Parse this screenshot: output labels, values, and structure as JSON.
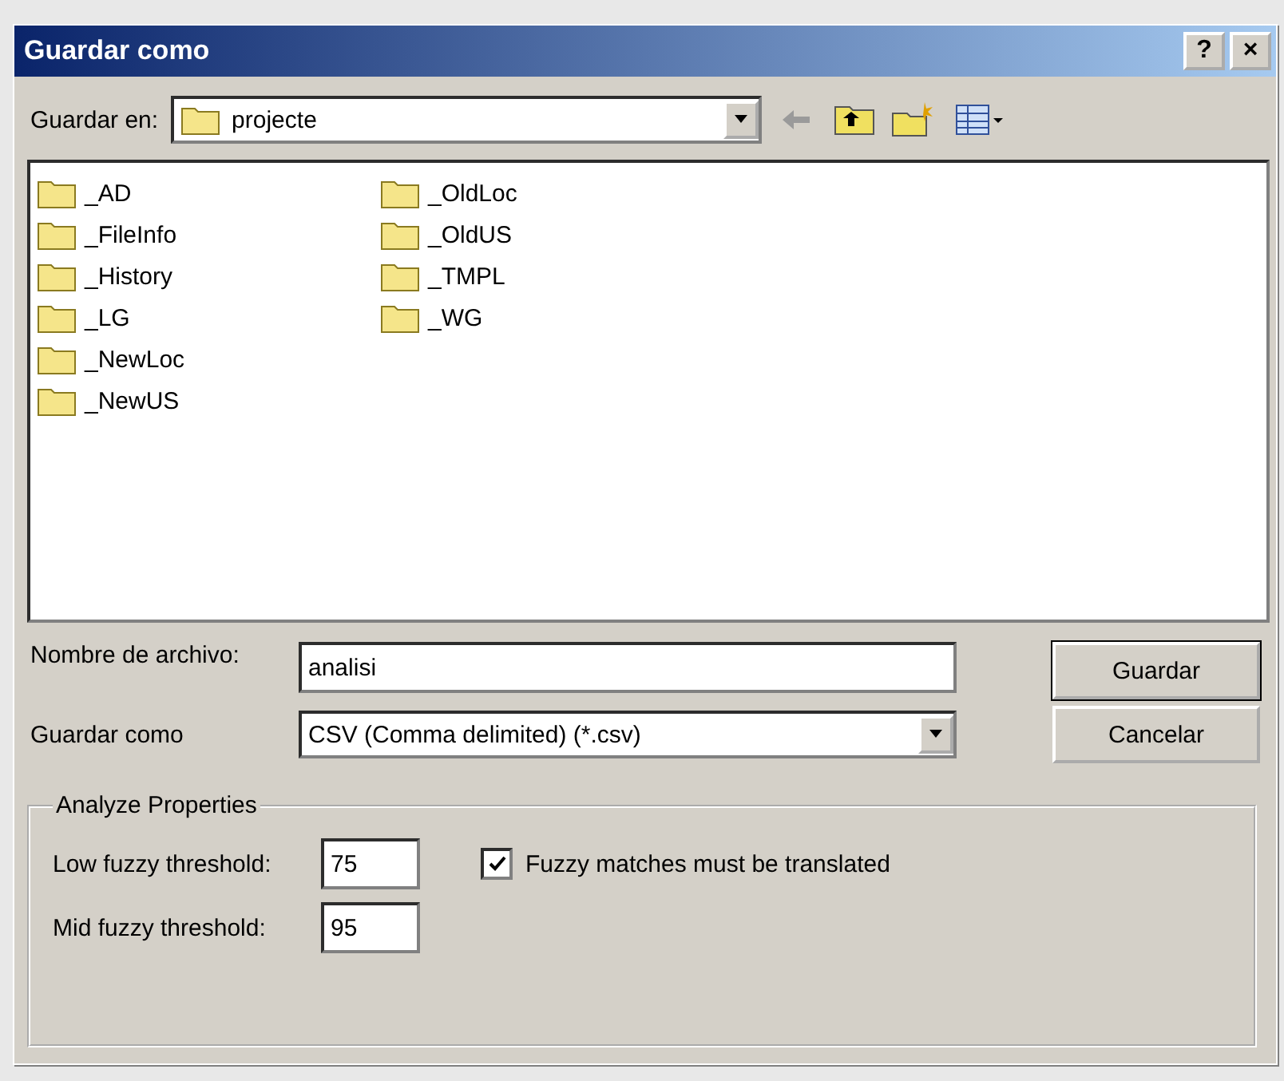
{
  "window": {
    "title": "Guardar como",
    "title_buttons": [
      "?",
      "×"
    ]
  },
  "location": {
    "label": "Guardar en:",
    "value": "projecte"
  },
  "folders": [
    {
      "name": "_AD"
    },
    {
      "name": "_FileInfo"
    },
    {
      "name": "_History"
    },
    {
      "name": "_LG"
    },
    {
      "name": "_NewLoc"
    },
    {
      "name": "_NewUS"
    },
    {
      "name": "_OldLoc"
    },
    {
      "name": "_OldUS"
    },
    {
      "name": "_TMPL"
    },
    {
      "name": "_WG"
    }
  ],
  "filename": {
    "label": "Nombre de archivo:",
    "value": "analisi"
  },
  "filetype": {
    "label": "Guardar como",
    "value": "CSV (Comma delimited) (*.csv)"
  },
  "buttons": [
    "Guardar",
    "Cancelar"
  ],
  "group": {
    "title": "Analyze Properties",
    "low_label": "Low fuzzy threshold:",
    "low_value": "75",
    "mid_label": "Mid fuzzy threshold:",
    "mid_value": "95",
    "check": {
      "label": "Fuzzy matches must be translated",
      "checked": true
    }
  }
}
